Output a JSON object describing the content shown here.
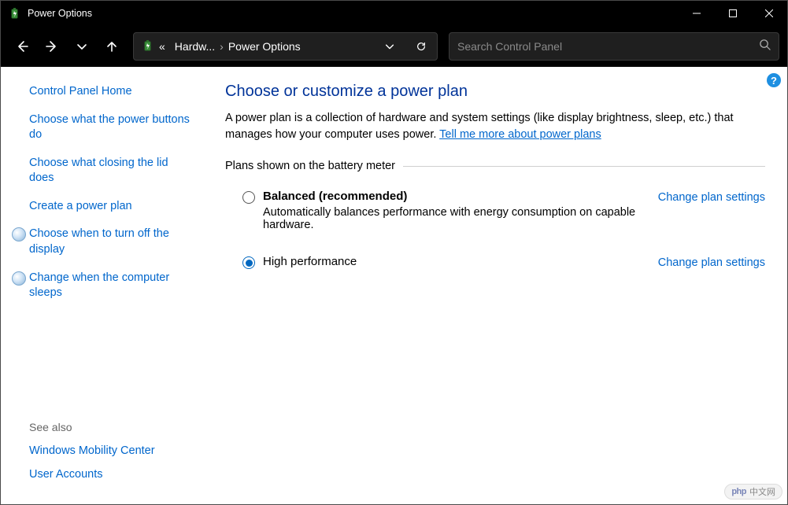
{
  "titlebar": {
    "title": "Power Options"
  },
  "breadcrumb": {
    "prefix": "«",
    "part1": "Hardw...",
    "part2": "Power Options"
  },
  "search": {
    "placeholder": "Search Control Panel"
  },
  "help": {
    "symbol": "?"
  },
  "sidebar": {
    "home": "Control Panel Home",
    "links": [
      "Choose what the power buttons do",
      "Choose what closing the lid does",
      "Create a power plan",
      "Choose when to turn off the display",
      "Change when the computer sleeps"
    ],
    "see_also_label": "See also",
    "see_also": [
      "Windows Mobility Center",
      "User Accounts"
    ]
  },
  "main": {
    "heading": "Choose or customize a power plan",
    "desc_pre": "A power plan is a collection of hardware and system settings (like display brightness, sleep, etc.) that manages how your computer uses power. ",
    "desc_link": "Tell me more about power plans",
    "group_label": "Plans shown on the battery meter",
    "plans": [
      {
        "name": "Balanced (recommended)",
        "sub": "Automatically balances performance with energy consumption on capable hardware.",
        "change": "Change plan settings",
        "selected": false,
        "bold": true
      },
      {
        "name": "High performance",
        "sub": "",
        "change": "Change plan settings",
        "selected": true,
        "bold": false
      }
    ]
  },
  "watermark": {
    "brand": "php",
    "text": "中文网"
  }
}
